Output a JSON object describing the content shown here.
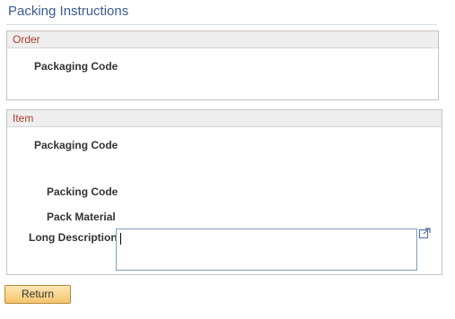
{
  "page": {
    "title": "Packing Instructions"
  },
  "order_section": {
    "header": "Order",
    "packaging_code_label": "Packaging Code"
  },
  "item_section": {
    "header": "Item",
    "packaging_code_label": "Packaging Code",
    "packing_code_label": "Packing Code",
    "pack_material_label": "Pack Material",
    "long_description_label": "Long Description",
    "long_description_value": "",
    "expand_icon": "expand-textarea-icon"
  },
  "actions": {
    "return_label": "Return"
  },
  "colors": {
    "title": "#3a5b8f",
    "section_header": "#a53f2b",
    "button_top": "#fde6b4",
    "button_bottom": "#f5c46e"
  }
}
